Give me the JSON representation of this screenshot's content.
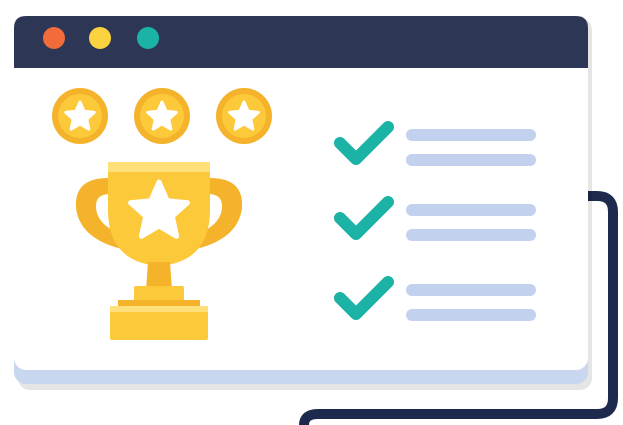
{
  "colors": {
    "titlebar": "#2e3656",
    "window_bg": "#ffffff",
    "window_bottom_band": "#c8d6f0",
    "outer_frame": "#1d2a4d",
    "dot_red": "#f26b3a",
    "dot_yellow": "#fbd23f",
    "dot_teal": "#1ab3a6",
    "gold": "#fcc93a",
    "gold_dark": "#f5b22b",
    "gold_light": "#fde07a",
    "star_white": "#ffffff",
    "check": "#1ab3a6",
    "line": "#c2d2ee"
  },
  "window": {
    "controls": [
      "close-dot",
      "minimize-dot",
      "maximize-dot"
    ]
  },
  "illustration": {
    "top_stars_count": 3,
    "trophy_icon": "trophy-icon",
    "star_icon": "star-icon",
    "checklist": [
      {
        "icon": "check-icon",
        "lines": 2
      },
      {
        "icon": "check-icon",
        "lines": 2
      },
      {
        "icon": "check-icon",
        "lines": 2
      }
    ]
  }
}
